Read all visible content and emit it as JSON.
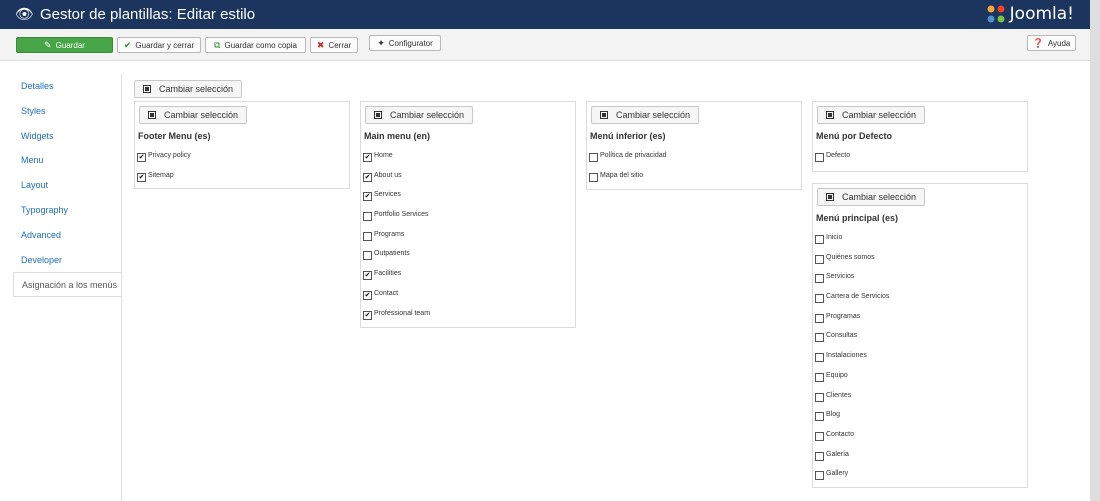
{
  "header": {
    "title": "Gestor de plantillas: Editar estilo",
    "logo_text": "Joomla!"
  },
  "toolbar": {
    "save_label": "Guardar",
    "save_close_label": "Guardar y cerrar",
    "save_copy_label": "Guardar como copia",
    "close_label": "Cerrar",
    "configurator_label": "Configurator",
    "help_label": "Ayuda"
  },
  "sidebar": {
    "items": [
      {
        "label": "Detalles"
      },
      {
        "label": "Styles"
      },
      {
        "label": "Widgets"
      },
      {
        "label": "Menu"
      },
      {
        "label": "Layout"
      },
      {
        "label": "Typography"
      },
      {
        "label": "Advanced"
      },
      {
        "label": "Developer"
      },
      {
        "label": "Asignación a los menús",
        "active": true
      }
    ]
  },
  "toggle_all_label": "Cambiar selección",
  "menus": [
    {
      "title": "Footer Menu (es)",
      "toggle_label": "Cambiar selección",
      "items": [
        {
          "label": "Privacy policy",
          "checked": true
        },
        {
          "label": "Sitemap",
          "checked": true
        }
      ]
    },
    {
      "title": "Main menu (en)",
      "toggle_label": "Cambiar selección",
      "items": [
        {
          "label": "Home",
          "checked": true
        },
        {
          "label": "About us",
          "checked": true
        },
        {
          "label": "Services",
          "checked": true
        },
        {
          "label": "Portfolio Services",
          "checked": false
        },
        {
          "label": "Programs",
          "checked": false
        },
        {
          "label": "Outpatients",
          "checked": false
        },
        {
          "label": "Facilities",
          "checked": true
        },
        {
          "label": "Contact",
          "checked": true
        },
        {
          "label": "Professional team",
          "checked": true
        }
      ]
    },
    {
      "title": "Menú inferior (es)",
      "toggle_label": "Cambiar selección",
      "items": [
        {
          "label": "Política de privacidad",
          "checked": false
        },
        {
          "label": "Mapa del sitio",
          "checked": false
        }
      ]
    },
    {
      "title": "Menú por Defecto",
      "toggle_label": "Cambiar selección",
      "items": [
        {
          "label": "Defecto",
          "checked": false
        }
      ]
    },
    {
      "title": "Menú principal (es)",
      "toggle_label": "Cambiar selección",
      "items": [
        {
          "label": "Inicio",
          "checked": false
        },
        {
          "label": "Quiénes somos",
          "checked": false
        },
        {
          "label": "Servicios",
          "checked": false
        },
        {
          "label": "Cartera de Servicios",
          "checked": false
        },
        {
          "label": "Programas",
          "checked": false
        },
        {
          "label": "Consultas",
          "checked": false
        },
        {
          "label": "Instalaciones",
          "checked": false
        },
        {
          "label": "Equipo",
          "checked": false
        },
        {
          "label": "Clientes",
          "checked": false
        },
        {
          "label": "Blog",
          "checked": false
        },
        {
          "label": "Contacto",
          "checked": false
        },
        {
          "label": "Galería",
          "checked": false
        },
        {
          "label": "Gallery",
          "checked": false
        }
      ]
    }
  ],
  "colors": {
    "header_bg": "#1b355f",
    "save_button": "#46a546",
    "link": "#1e6fb8"
  }
}
